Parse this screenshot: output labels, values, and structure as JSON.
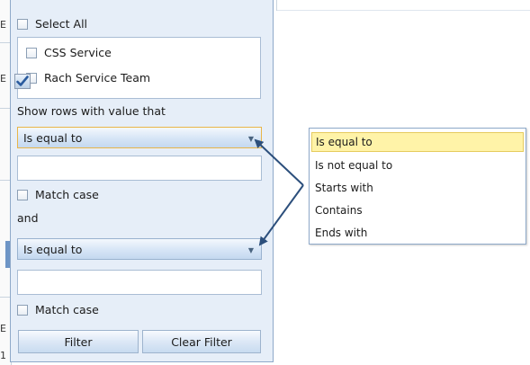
{
  "background_grid": {
    "row_fragments": [
      "E",
      "E",
      "E",
      "1"
    ]
  },
  "filter_popup": {
    "select_all_label": "Select All",
    "values": [
      {
        "label": "CSS Service",
        "checked": false
      },
      {
        "label": "Rach Service Team",
        "checked": false
      }
    ],
    "show_rows_label": "Show rows with value that",
    "condition1": {
      "selected": "Is equal to",
      "value": "",
      "match_case_label": "Match case"
    },
    "logic_operator": "and",
    "condition2": {
      "selected": "Is equal to",
      "value": "",
      "match_case_label": "Match case"
    },
    "filter_button": "Filter",
    "clear_filter_button": "Clear Filter"
  },
  "dropdown": {
    "options": [
      "Is equal to",
      "Is not equal to",
      "Starts with",
      "Contains",
      "Ends with"
    ],
    "selected": "Is equal to"
  },
  "colors": {
    "popup_bg": "#e6eef8",
    "border": "#8ea9c9",
    "selection_highlight": "#fff3a8",
    "annotation_arrow": "#2c4f7c"
  }
}
